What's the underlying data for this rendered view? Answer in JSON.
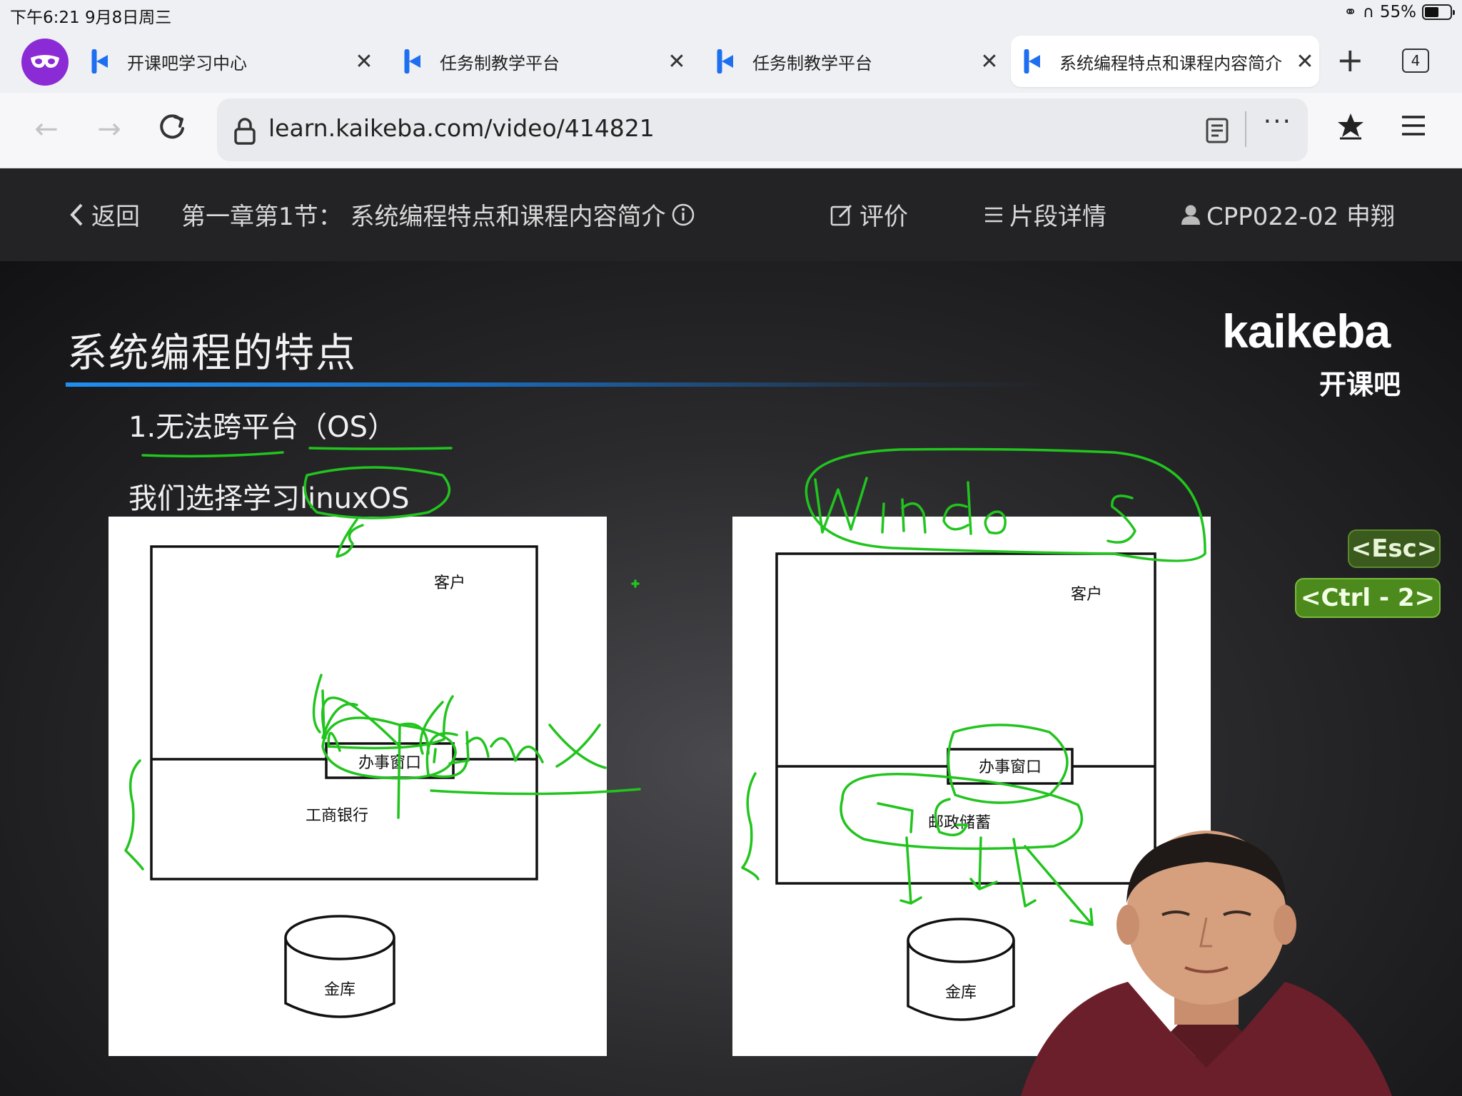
{
  "status_bar": {
    "time_date": "下午6:21   9月8日周三",
    "battery": "55%",
    "battery_level": 0.55
  },
  "tabs": [
    {
      "title": "开课吧学习中心",
      "active": false
    },
    {
      "title": "任务制教学平台",
      "active": false
    },
    {
      "title": "任务制教学平台",
      "active": false
    },
    {
      "title": "系统编程特点和课程内容简介",
      "active": true
    }
  ],
  "tab_count": "4",
  "address_bar": {
    "url": "learn.kaikeba.com/video/414821"
  },
  "site_header": {
    "back": "返回",
    "lesson_title": "第一章第1节：  系统编程特点和课程内容简介",
    "review": "评价",
    "segments": "片段详情",
    "user": "CPP022-02 申翔"
  },
  "slide": {
    "title": "系统编程的特点",
    "logo": "kaikeba",
    "logo_cn": "开课吧",
    "point1": "1.无法跨平台（OS）",
    "point2": "我们选择学习linuxOS",
    "left_diagram": {
      "customer": "客户",
      "window": "办事窗口",
      "bank": "工商银行",
      "vault": "金库"
    },
    "right_diagram": {
      "customer": "客户",
      "window": "办事窗口",
      "bank": "邮政储蓄",
      "vault": "金库"
    }
  },
  "shortcut_hints": {
    "esc": "<Esc>",
    "ctrl": "<Ctrl - 2>"
  },
  "colors": {
    "accent_purple": "#8b2bd6",
    "header_bg": "#232325",
    "annotation_green": "#22c41e",
    "title_rule_blue": "#1f8ff0"
  }
}
